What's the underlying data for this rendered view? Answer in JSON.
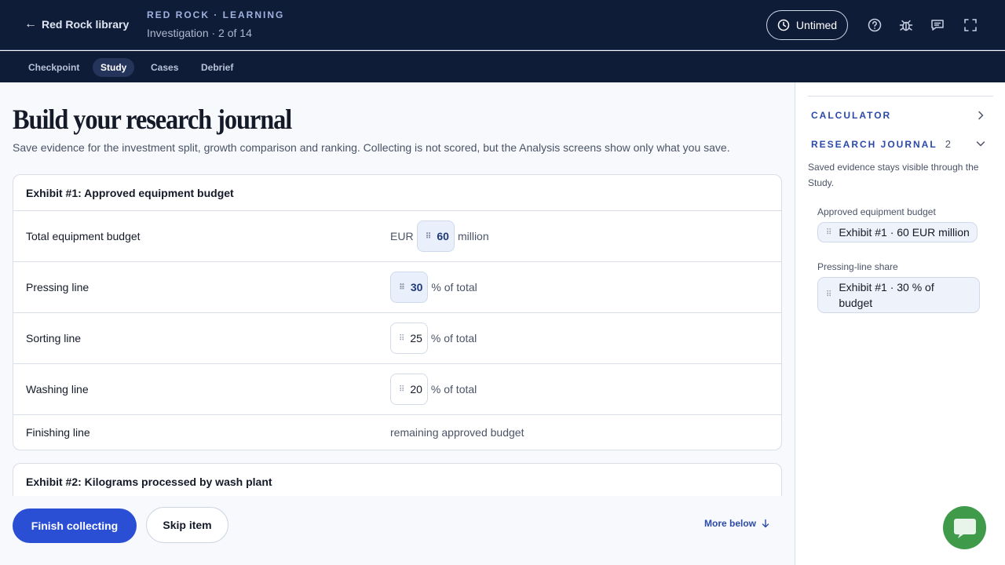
{
  "header": {
    "back_label": "Red Rock library",
    "brand": "RED ROCK · LEARNING",
    "progress": "Investigation · 2 of 14",
    "timer_label": "Untimed",
    "icons": [
      "clock-icon",
      "help-icon",
      "bug-icon",
      "feedback-icon",
      "fullscreen-icon"
    ]
  },
  "tabs": [
    {
      "label": "Checkpoint"
    },
    {
      "label": "Study",
      "active": true
    },
    {
      "label": "Cases"
    },
    {
      "label": "Debrief"
    }
  ],
  "main": {
    "title": "Build your research journal",
    "subtitle": "Save evidence for the investment split, growth comparison and ranking. Collecting is not scored, but the Analysis screens show only what you save.",
    "exhibit1": {
      "title": "Exhibit #1: Approved equipment budget",
      "rows": [
        {
          "label": "Total equipment budget",
          "prefix": "EUR",
          "value": "60",
          "suffix": "million"
        },
        {
          "label": "Pressing line",
          "value": "30",
          "suffix": "% of total"
        },
        {
          "label": "Sorting line",
          "value": "25",
          "suffix": "% of total"
        },
        {
          "label": "Washing line",
          "value": "20",
          "suffix": "% of total"
        },
        {
          "label": "Finishing line",
          "text": "remaining approved budget"
        }
      ]
    },
    "exhibit2": {
      "title": "Exhibit #2: Kilograms processed by wash plant"
    }
  },
  "footer": {
    "finish_label": "Finish collecting",
    "skip_label": "Skip item",
    "more_label": "More below"
  },
  "sidebar": {
    "calculator_label": "CALCULATOR",
    "journal_label": "RESEARCH JOURNAL",
    "journal_count": "2",
    "note": "Saved evidence stays visible through the Study.",
    "evidence": [
      {
        "label": "Approved equipment budget",
        "chip": "Exhibit #1 · 60 EUR million"
      },
      {
        "label": "Pressing-line share",
        "chip": "Exhibit #1 · 30 % of budget"
      }
    ]
  },
  "colors": {
    "header_bg": "#0f1c38",
    "accent": "#2b4fd4",
    "saved_chip": "#eaf0fb",
    "chat_fab": "#3f9a4a"
  }
}
